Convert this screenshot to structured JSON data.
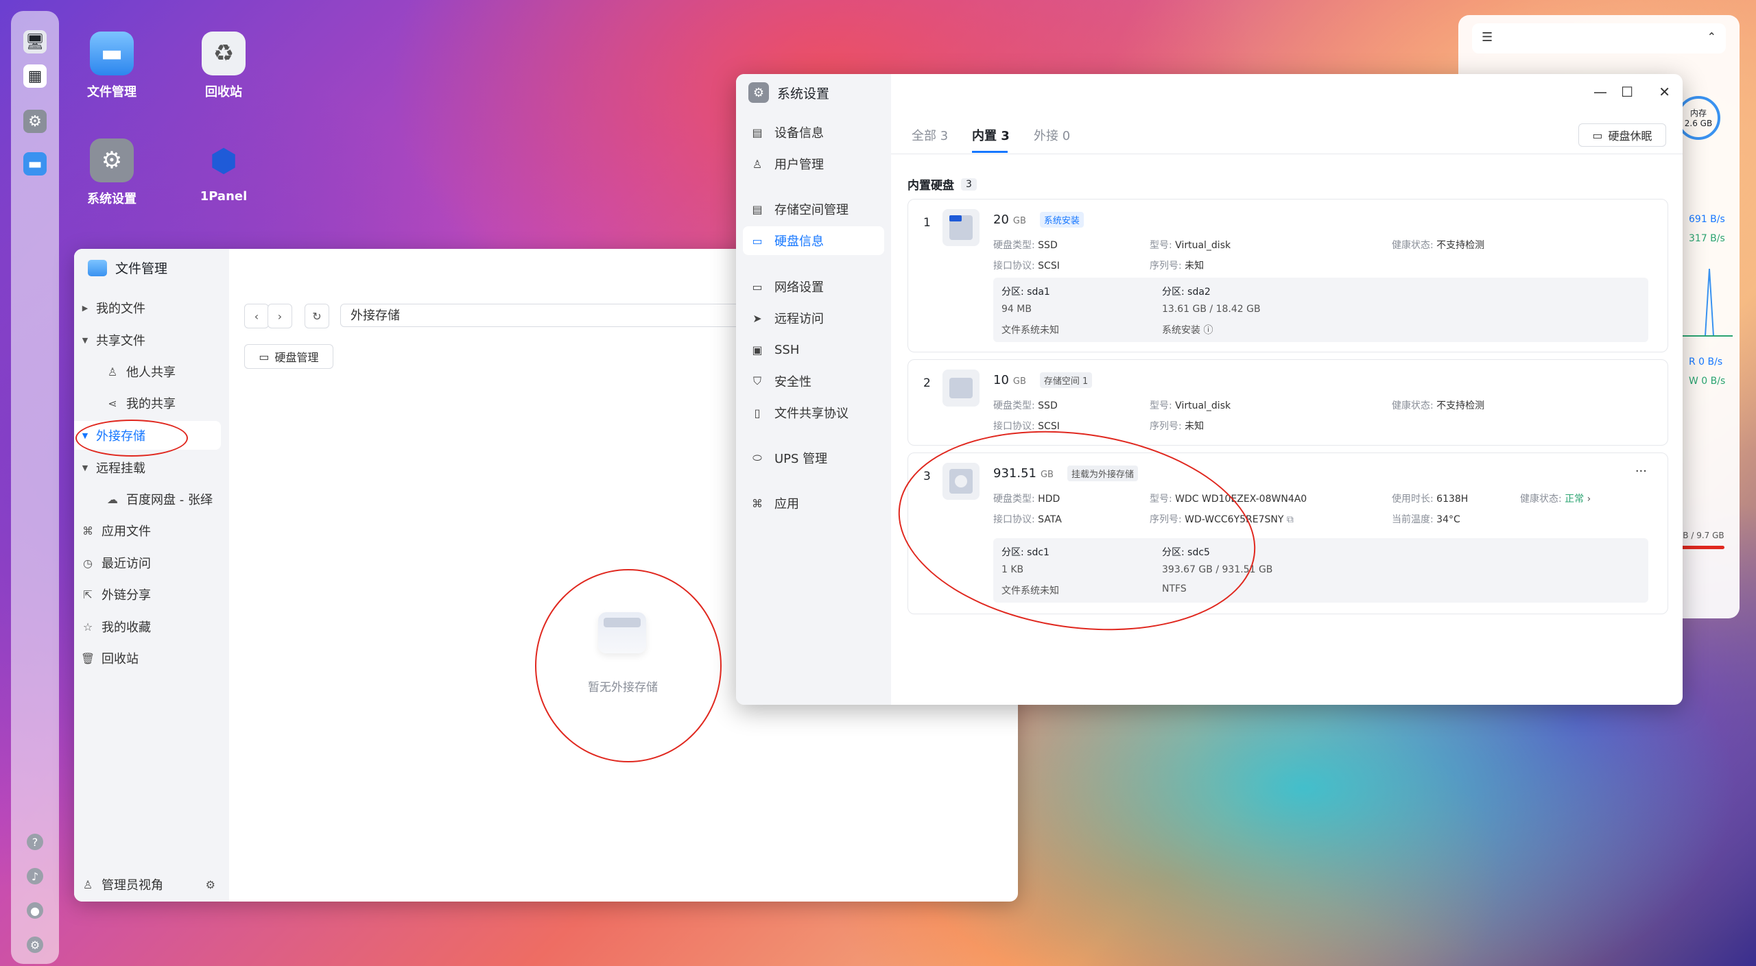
{
  "desktop": {
    "icons": [
      {
        "label": "文件管理"
      },
      {
        "label": "回收站"
      },
      {
        "label": "系统设置"
      },
      {
        "label": "1Panel"
      }
    ]
  },
  "file_manager": {
    "title": "文件管理",
    "nav": [
      {
        "label": "我的文件"
      },
      {
        "label": "共享文件"
      },
      {
        "label": "他人共享"
      },
      {
        "label": "我的共享"
      },
      {
        "label": "外接存储"
      },
      {
        "label": "远程挂载"
      },
      {
        "label": "百度网盘 - 张绎"
      },
      {
        "label": "应用文件"
      },
      {
        "label": "最近访问"
      },
      {
        "label": "外链分享"
      },
      {
        "label": "我的收藏"
      },
      {
        "label": "回收站"
      }
    ],
    "footer_label": "管理员视角",
    "path": "外接存储",
    "disk_manage_button": "硬盘管理",
    "empty_text": "暂无外接存储"
  },
  "settings": {
    "title": "系统设置",
    "nav": [
      {
        "label": "设备信息"
      },
      {
        "label": "用户管理"
      },
      {
        "label": "存储空间管理"
      },
      {
        "label": "硬盘信息"
      },
      {
        "label": "网络设置"
      },
      {
        "label": "远程访问"
      },
      {
        "label": "SSH"
      },
      {
        "label": "安全性"
      },
      {
        "label": "文件共享协议"
      },
      {
        "label": "UPS 管理"
      },
      {
        "label": "应用"
      }
    ],
    "tabs": [
      {
        "label": "全部 3"
      },
      {
        "label": "内置 3"
      },
      {
        "label": "外接 0"
      }
    ],
    "sleep_button": "硬盘休眠",
    "section_title": "内置硬盘",
    "section_count": "3",
    "disks": [
      {
        "num": "1",
        "capacity": "20",
        "unit": "GB",
        "tag": "系统安装",
        "type_label": "硬盘类型:",
        "type": "SSD",
        "model_label": "型号:",
        "model": "Virtual_disk",
        "health_label": "健康状态:",
        "health": "不支持检测",
        "iface_label": "接口协议:",
        "iface": "SCSI",
        "serial_label": "序列号:",
        "serial": "未知",
        "partitions": [
          {
            "name": "分区: sda1",
            "size": "94 MB",
            "fs": "文件系统未知"
          },
          {
            "name": "分区: sda2",
            "size": "13.61 GB / 18.42 GB",
            "fs": "系统安装 ⓘ"
          }
        ]
      },
      {
        "num": "2",
        "capacity": "10",
        "unit": "GB",
        "tag": "存储空间 1",
        "type_label": "硬盘类型:",
        "type": "SSD",
        "model_label": "型号:",
        "model": "Virtual_disk",
        "health_label": "健康状态:",
        "health": "不支持检测",
        "iface_label": "接口协议:",
        "iface": "SCSI",
        "serial_label": "序列号:",
        "serial": "未知"
      },
      {
        "num": "3",
        "capacity": "931.51",
        "unit": "GB",
        "tag": "挂载为外接存储",
        "type_label": "硬盘类型:",
        "type": "HDD",
        "model_label": "型号:",
        "model": "WDC WD10EZEX-08WN4A0",
        "usage_label": "使用时长:",
        "usage": "6138H",
        "health_label": "健康状态:",
        "health": "正常",
        "iface_label": "接口协议:",
        "iface": "SATA",
        "serial_label": "序列号:",
        "serial": "WD-WCC6Y5RE7SNY",
        "temp_label": "当前温度:",
        "temp": "34°C",
        "more": "···",
        "partitions": [
          {
            "name": "分区: sdc1",
            "size": "1 KB",
            "fs": "文件系统未知"
          },
          {
            "name": "分区: sdc5",
            "size": "393.67 GB / 931.51 GB",
            "fs": "NTFS"
          }
        ]
      }
    ]
  },
  "widgets": {
    "mem_label": "内存",
    "mem_value": "2.6 GB",
    "net_up": "691 B/s",
    "net_down": "317 B/s",
    "disk_r": "R  0 B/s",
    "disk_w": "W  0 B/s",
    "storage": "GB / 9.7 GB"
  },
  "colors": {
    "accent": "#1677ff",
    "annotation_red": "#e0281f",
    "healthy_green": "#2ba471"
  }
}
